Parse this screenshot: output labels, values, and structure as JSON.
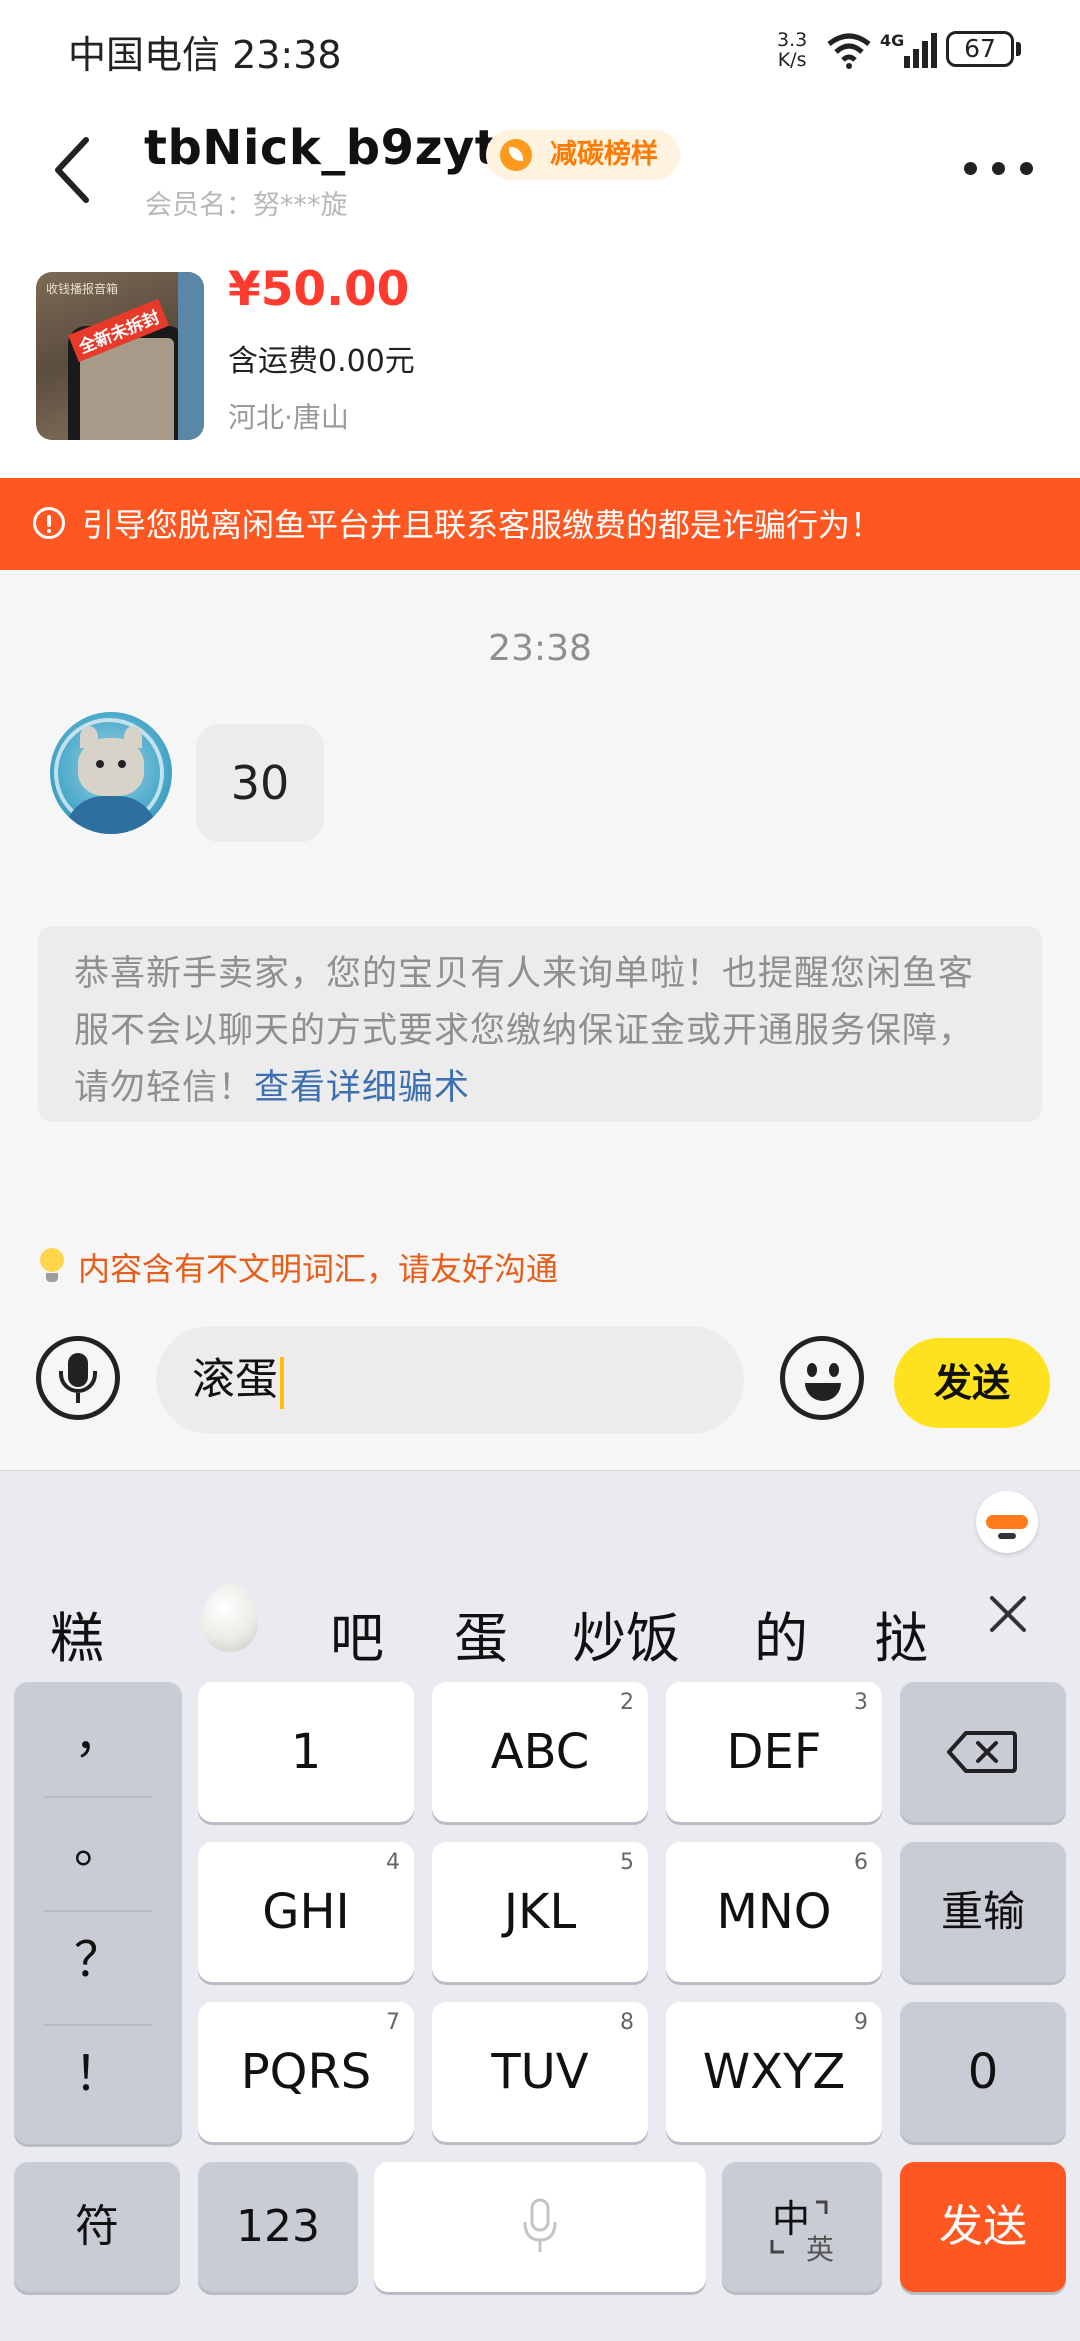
{
  "status_bar": {
    "carrier_time": "中国电信 23:38",
    "speed_value": "3.3",
    "speed_unit": "K/s",
    "network": "4G",
    "battery": "67"
  },
  "header": {
    "title": "tbNick_b9zyt",
    "badge": "减碳榜样",
    "member_name": "会员名：努***旋"
  },
  "product": {
    "thumb_tag": "全新未拆封",
    "thumb_caption": "收钱播报音箱",
    "price": "¥50.00",
    "shipping": "含运费0.00元",
    "location": "河北·唐山"
  },
  "warning_banner": {
    "text": "引导您脱离闲鱼平台并且联系客服缴费的都是诈骗行为！"
  },
  "chat": {
    "timestamp": "23:38",
    "message": "30",
    "system_notice": "恭喜新手卖家，您的宝贝有人来询单啦！也提醒您闲鱼客服不会以聊天的方式要求您缴纳保证金或开通服务保障，请勿轻信！",
    "system_notice_link": "查看详细骗术",
    "civility_warning": "内容含有不文明词汇，请友好沟通"
  },
  "input": {
    "value": "滚蛋",
    "send_label": "发送"
  },
  "keyboard": {
    "candidates": [
      "糕",
      "吧",
      "蛋",
      "炒饭",
      "的",
      "挞"
    ],
    "punctuation": [
      "，",
      "。",
      "？",
      "！"
    ],
    "keys_row1": [
      {
        "label": "1",
        "num": ""
      },
      {
        "label": "ABC",
        "num": "2"
      },
      {
        "label": "DEF",
        "num": "3"
      }
    ],
    "keys_row2": [
      {
        "label": "GHI",
        "num": "4"
      },
      {
        "label": "JKL",
        "num": "5"
      },
      {
        "label": "MNO",
        "num": "6"
      }
    ],
    "keys_row3": [
      {
        "label": "PQRS",
        "num": "7"
      },
      {
        "label": "TUV",
        "num": "8"
      },
      {
        "label": "WXYZ",
        "num": "9"
      }
    ],
    "reinput_label": "重输",
    "zero_label": "0",
    "symbol_label": "符",
    "numeric_label": "123",
    "lang_primary": "中",
    "lang_secondary": "英",
    "send_label": "发送"
  }
}
